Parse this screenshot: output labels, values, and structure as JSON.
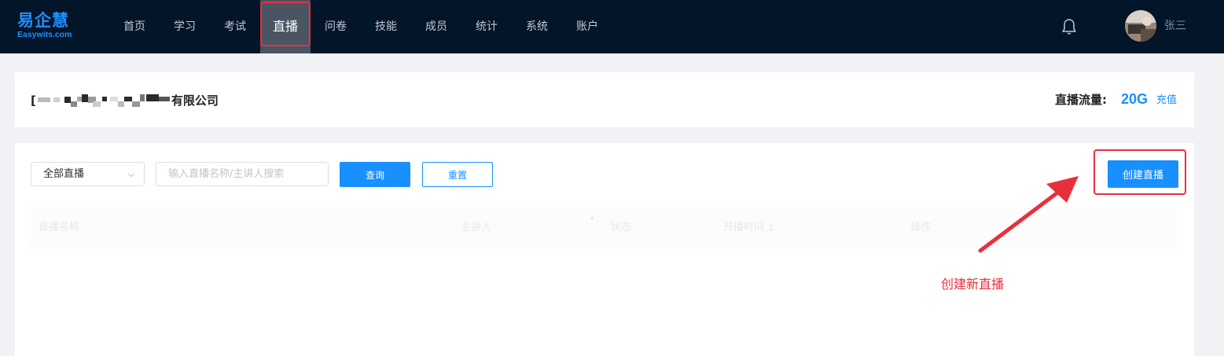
{
  "brand": {
    "logo_cn": "易企慧",
    "logo_en": "Easywits.com",
    "color": "#1890ff"
  },
  "nav": {
    "items": [
      {
        "label": "首页"
      },
      {
        "label": "学习"
      },
      {
        "label": "考试"
      },
      {
        "label": "直播",
        "active": true
      },
      {
        "label": "问卷"
      },
      {
        "label": "技能"
      },
      {
        "label": "成员"
      },
      {
        "label": "统计"
      },
      {
        "label": "系统"
      },
      {
        "label": "账户"
      }
    ],
    "bell_icon": "bell-icon",
    "user_name": "张三"
  },
  "company": {
    "name_visible": "[",
    "name_suffix": "有限公司",
    "traffic_label": "直播流量:",
    "traffic_value": "20G",
    "recharge": "充值"
  },
  "filters": {
    "select_value": "全部直播",
    "search_placeholder": "输入直播名称/主讲人搜索",
    "query_label": "查询",
    "reset_label": "重置",
    "create_label": "创建直播"
  },
  "table": {
    "columns": [
      "直播名称",
      "主讲人",
      "状态",
      "开播时间",
      "操作"
    ],
    "rows": []
  },
  "annotation": {
    "text": "创建新直播",
    "color": "#e8303c"
  }
}
